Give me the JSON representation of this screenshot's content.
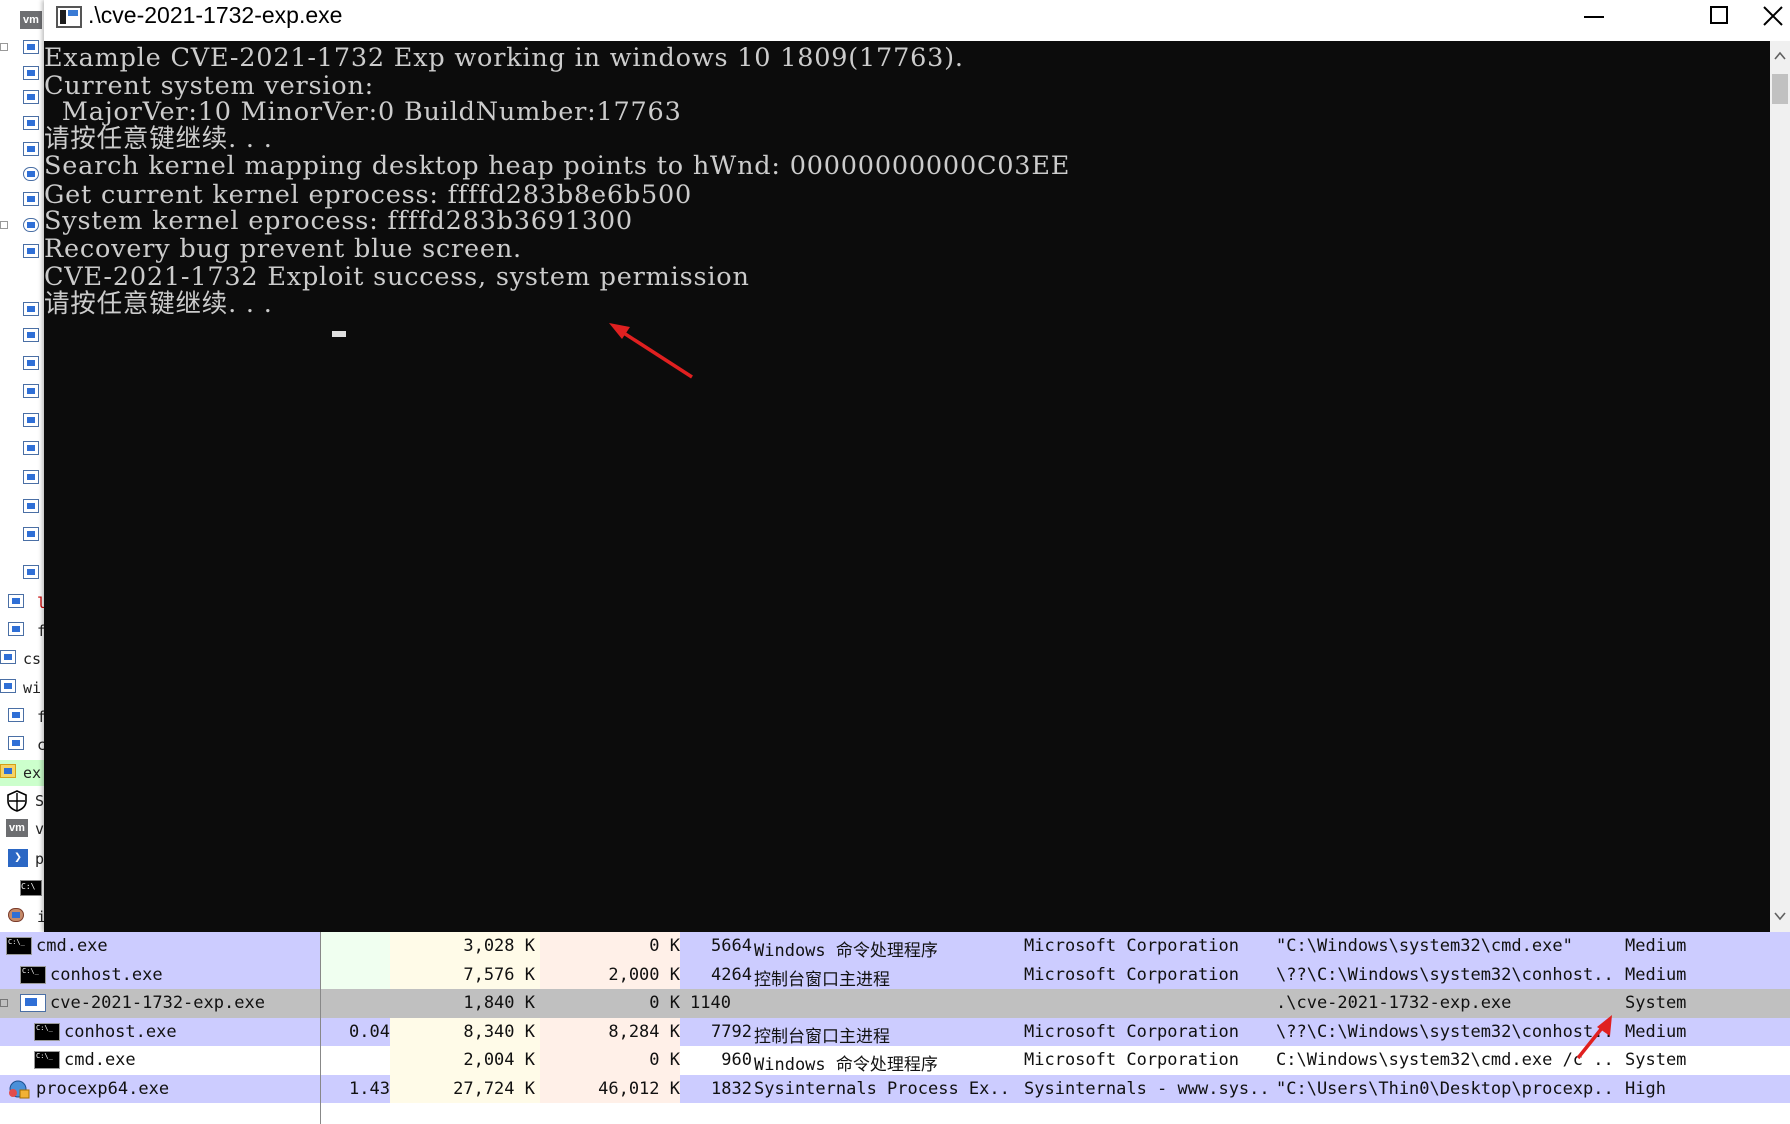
{
  "window": {
    "title": ".\\cve-2021-1732-exp.exe"
  },
  "console": {
    "lines": [
      "Example CVE-2021-1732 Exp working in windows 10 1809(17763).",
      "Current system version:",
      "  MajorVer:10 MinorVer:0 BuildNumber:17763",
      "请按任意键继续. . .",
      "Search kernel mapping desktop heap points to hWnd: 00000000000C03EE",
      "Get current kernel eprocess: ffffd283b8e6b500",
      "System kernel eprocess: ffffd283b3691300",
      "Recovery bug prevent blue screen.",
      "CVE-2021-1732 Exploit success, system permission",
      "请按任意键继续. . ."
    ]
  },
  "left_strip": {
    "labels": [
      "l",
      "f",
      "cs",
      "wi",
      "f",
      "c",
      "ex",
      "S",
      "v",
      "p",
      "i"
    ]
  },
  "process_table": {
    "rows": [
      {
        "name": "cmd.exe",
        "cpu": "",
        "private_bytes": "3,028 K",
        "working_set": "0 K",
        "pid": "5664",
        "description": "Windows 命令处理程序",
        "company": "Microsoft Corporation",
        "command_line": "\"C:\\Windows\\system32\\cmd.exe\"",
        "integrity": "Medium",
        "icon": "console-icon"
      },
      {
        "name": "conhost.exe",
        "cpu": "",
        "private_bytes": "7,576 K",
        "working_set": "2,000 K",
        "pid": "4264",
        "description": "控制台窗口主进程",
        "company": "Microsoft Corporation",
        "command_line": "\\??\\C:\\Windows\\system32\\conhost...",
        "integrity": "Medium",
        "icon": "console-icon"
      },
      {
        "name": "cve-2021-1732-exp.exe",
        "cpu": "",
        "private_bytes": "1,840 K",
        "working_set": "0 K",
        "pid": "1140",
        "description": "",
        "company": "",
        "command_line": ".\\cve-2021-1732-exp.exe",
        "integrity": "System",
        "icon": "app-window-icon"
      },
      {
        "name": "conhost.exe",
        "cpu": "0.04",
        "private_bytes": "8,340 K",
        "working_set": "8,284 K",
        "pid": "7792",
        "description": "控制台窗口主进程",
        "company": "Microsoft Corporation",
        "command_line": "\\??\\C:\\Windows\\system32\\conhost...",
        "integrity": "Medium",
        "icon": "console-icon"
      },
      {
        "name": "cmd.exe",
        "cpu": "",
        "private_bytes": "2,004 K",
        "working_set": "0 K",
        "pid": "960",
        "description": "Windows 命令处理程序",
        "company": "Microsoft Corporation",
        "command_line": "C:\\Windows\\system32\\cmd.exe /c ...",
        "integrity": "System",
        "icon": "console-icon"
      },
      {
        "name": "procexp64.exe",
        "cpu": "1.43",
        "private_bytes": "27,724 K",
        "working_set": "46,012 K",
        "pid": "1832",
        "description": "Sysinternals Process Ex...",
        "company": "Sysinternals - www.sys...",
        "command_line": "\"C:\\Users\\Thin0\\Desktop\\procexp...",
        "integrity": "High",
        "icon": "process-explorer-icon"
      }
    ]
  },
  "colors": {
    "console_bg": "#0c0c0c",
    "console_text": "#cccccc",
    "row_purple": "#ccccff",
    "row_selected": "#c0c0c0",
    "annotation_arrow": "#e02020"
  }
}
